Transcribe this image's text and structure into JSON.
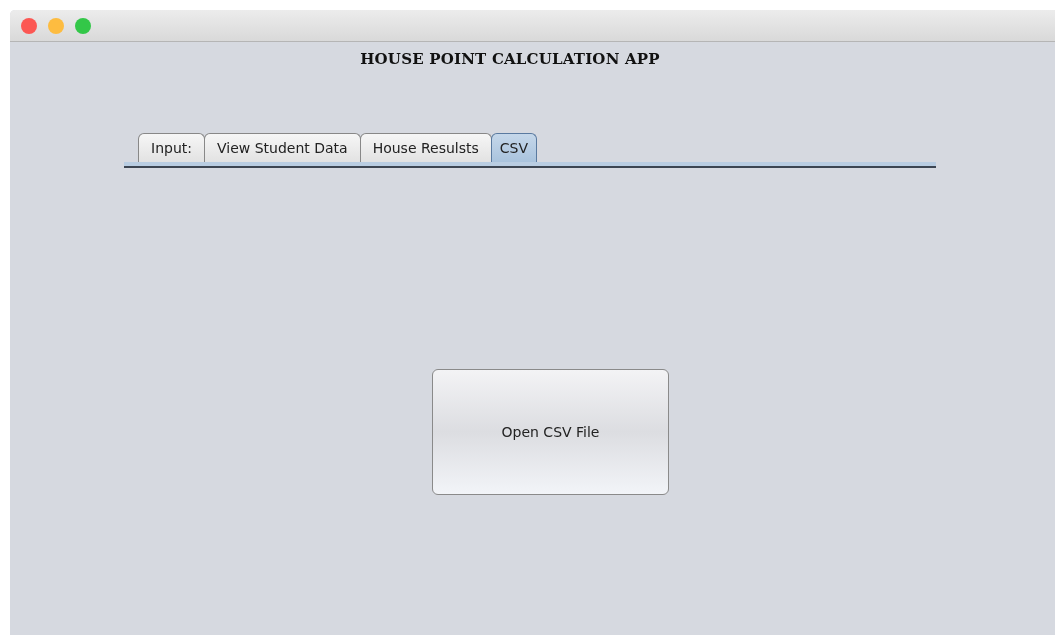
{
  "window": {
    "title": "HOUSE POINT CALCULATION APP"
  },
  "tabs": [
    {
      "label": "Input:",
      "selected": false
    },
    {
      "label": "View Student Data",
      "selected": false
    },
    {
      "label": "House Resulsts",
      "selected": false
    },
    {
      "label": "CSV",
      "selected": true
    }
  ],
  "open_button": {
    "label": "Open CSV File"
  }
}
